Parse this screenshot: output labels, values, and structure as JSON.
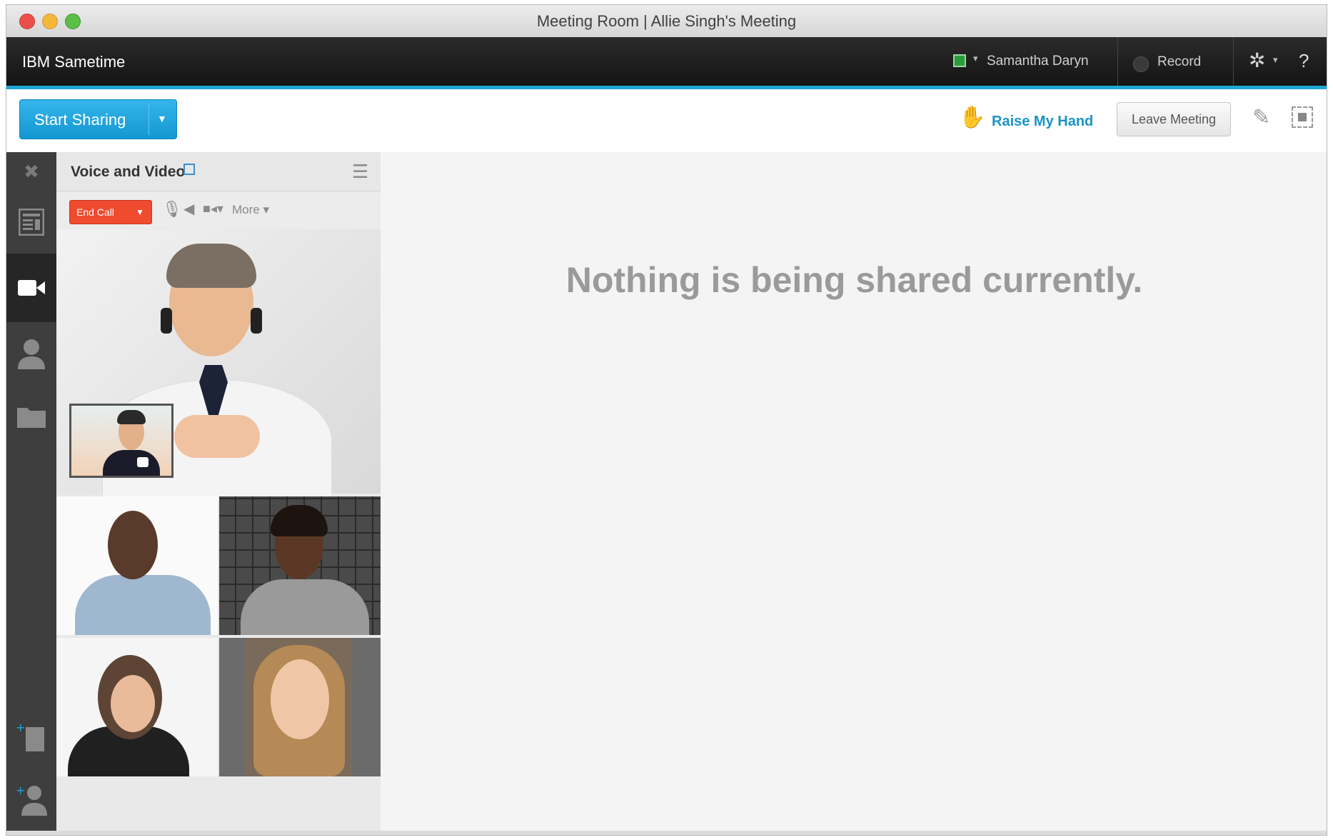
{
  "window": {
    "title": "Meeting Room  |  Allie Singh's Meeting"
  },
  "appbar": {
    "app_name": "IBM Sametime",
    "user_name": "Samantha Daryn",
    "record_label": "Record",
    "help_label": "?"
  },
  "toolbar": {
    "share_label": "Start Sharing",
    "raise_hand_label": "Raise My Hand",
    "leave_label": "Leave Meeting"
  },
  "panel": {
    "title": "Voice and Video",
    "end_call_label": "End Call",
    "more_label": "More ▾"
  },
  "content": {
    "empty_message": "Nothing is being shared currently."
  },
  "colors": {
    "accent": "#1da7d4",
    "share_button": "#1d9fd8",
    "end_call": "#ef4b2f",
    "raise_hand_text": "#1a93c9"
  }
}
